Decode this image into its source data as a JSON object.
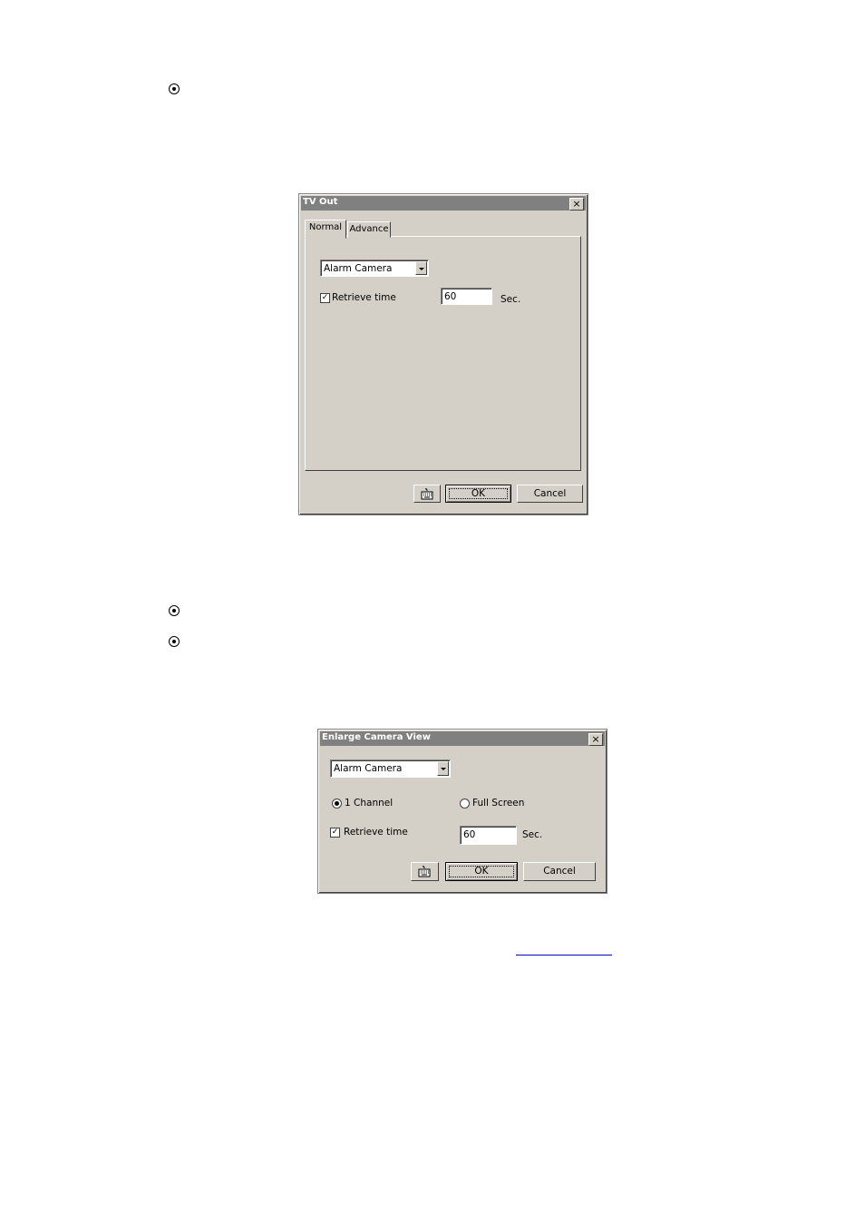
{
  "tv_out": {
    "title": "TV Out",
    "close_glyph": "×",
    "tabs": [
      {
        "label": "Normal"
      },
      {
        "label": "Advance"
      }
    ],
    "camera_select": {
      "value": "Alarm Camera"
    },
    "retrieve_checkbox": {
      "checked": true,
      "mark": "✓",
      "label": "Retrieve time"
    },
    "retrieve_time": {
      "value": "60",
      "unit": "Sec."
    },
    "buttons": {
      "keyboard_icon": "keyboard-icon",
      "ok": "OK",
      "cancel": "Cancel"
    }
  },
  "enlarge_view": {
    "title": "Enlarge Camera View",
    "close_glyph": "×",
    "camera_select": {
      "value": "Alarm Camera"
    },
    "radio_one_channel": {
      "label": "1 Channel",
      "selected": true
    },
    "radio_full_screen": {
      "label": "Full Screen",
      "selected": false
    },
    "retrieve_checkbox": {
      "checked": true,
      "mark": "✓",
      "label": "Retrieve time"
    },
    "retrieve_time": {
      "value": "60",
      "unit": "Sec."
    },
    "buttons": {
      "keyboard_icon": "keyboard-icon",
      "ok": "OK",
      "cancel": "Cancel"
    }
  },
  "colors": {
    "dialog_face": "#d4d0c8",
    "inactive_titlebar": "#808080",
    "link": "#0000cc"
  }
}
